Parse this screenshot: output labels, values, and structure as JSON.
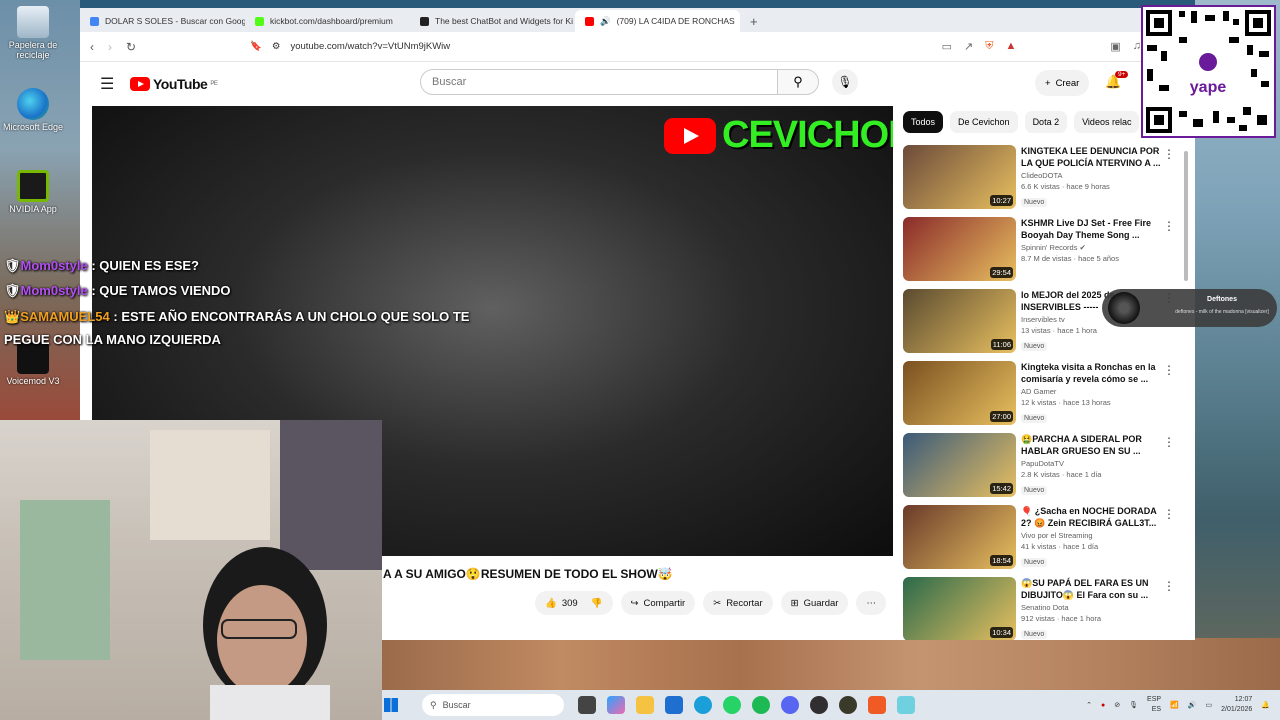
{
  "desktop": {
    "icons": [
      {
        "label": "Papelera de reciclaje"
      },
      {
        "label": "Microsoft Edge"
      },
      {
        "label": "NVIDIA App"
      },
      {
        "label": "Voicemod V3"
      }
    ]
  },
  "browser": {
    "tabs": [
      {
        "label": "DOLAR S SOLES - Buscar con Google",
        "color": "#4285f4"
      },
      {
        "label": "kickbot.com/dashboard/premium",
        "color": "#53fc18"
      },
      {
        "label": "The best ChatBot and Widgets for Ki",
        "color": "#222222"
      },
      {
        "label": "(709) LA C4IDA DE RONCHAS",
        "color": "#ff0000"
      }
    ],
    "url": "youtube.com/watch?v=VtUNm9jKWiw"
  },
  "youtube": {
    "logo": "YouTube",
    "region": "PE",
    "search_placeholder": "Buscar",
    "create_label": "Crear",
    "notif_count": "9+",
    "video_overlay_brand": "CEVICHON",
    "video_title": "A A SU AMIGO😲RESUMEN DE TODO EL SHOW🤯",
    "likes": "309",
    "share_label": "Compartir",
    "clip_label": "Recortar",
    "save_label": "Guardar",
    "chips": [
      "Todos",
      "De Cevichon",
      "Dota 2",
      "Videos relac"
    ],
    "recommendations": [
      {
        "title": "KINGTEKA LEE DENUNCIA POR LA QUE POLICÍA NTERVINO A ...",
        "channel": "ClideoDOTA",
        "meta": "6.6 K vistas · hace 9 horas",
        "badge": "Nuevo",
        "duration": "10:27",
        "color": "#6b4a3a"
      },
      {
        "title": "KSHMR Live DJ Set - Free Fire Booyah Day Theme Song ...",
        "channel": "Spinnin' Records ✔",
        "meta": "8.7 M de vistas · hace 5 años",
        "badge": "",
        "duration": "29:54",
        "color": "#8a2a2a"
      },
      {
        "title": "lo MEJOR del 2025 de INSERVIBLES -----",
        "channel": "Inservibles tv",
        "meta": "13 vistas · hace 1 hora",
        "badge": "Nuevo",
        "duration": "11:06",
        "color": "#5a4a30"
      },
      {
        "title": "Kingteka visita a Ronchas en la comisaría y revela cómo se ...",
        "channel": "AD Gamer",
        "meta": "12 k vistas · hace 13 horas",
        "badge": "Nuevo",
        "duration": "27:00",
        "color": "#7a5020"
      },
      {
        "title": "🤮PARCHA A SIDERAL POR HABLAR GRUESO EN SU ...",
        "channel": "PapuDotaTV",
        "meta": "2.8 K vistas · hace 1 día",
        "badge": "Nuevo",
        "duration": "15:42",
        "color": "#3a5a7a"
      },
      {
        "title": "🎈 ¿Sacha en NOCHE DORADA 2? 😡 Zein RECIBIRÁ GALL3T...",
        "channel": "Vivo por el Streaming",
        "meta": "41 k vistas · hace 1 día",
        "badge": "Nuevo",
        "duration": "18:54",
        "color": "#6a3a2a"
      },
      {
        "title": "😱SU PAPÁ DEL FARA ES UN DIBUJITO😱 El Fara con su ...",
        "channel": "Senatino Dota",
        "meta": "912 vistas · hace 1 hora",
        "badge": "Nuevo",
        "duration": "10:34",
        "color": "#2a6a4a"
      }
    ]
  },
  "chat": [
    {
      "user": "Mom0style",
      "msg": ": QUIEN ES ESE?"
    },
    {
      "user": "Mom0style",
      "msg": ": QUE TAMOS VIENDO"
    },
    {
      "user": "SAMAMUEL54",
      "msg": ": ESTE AÑO ENCONTRARÁS A UN CHOLO QUE SOLO TE PEGUE CON LA MANO IZQUIERDA"
    }
  ],
  "music_widget": {
    "artist": "Deftones",
    "track": "deftones - milk of the madonna [visualizer]"
  },
  "taskbar": {
    "search": "Buscar",
    "lang_top": "ESP",
    "lang_bottom": "ES",
    "time": "12:07",
    "date": "2/01/2026"
  }
}
